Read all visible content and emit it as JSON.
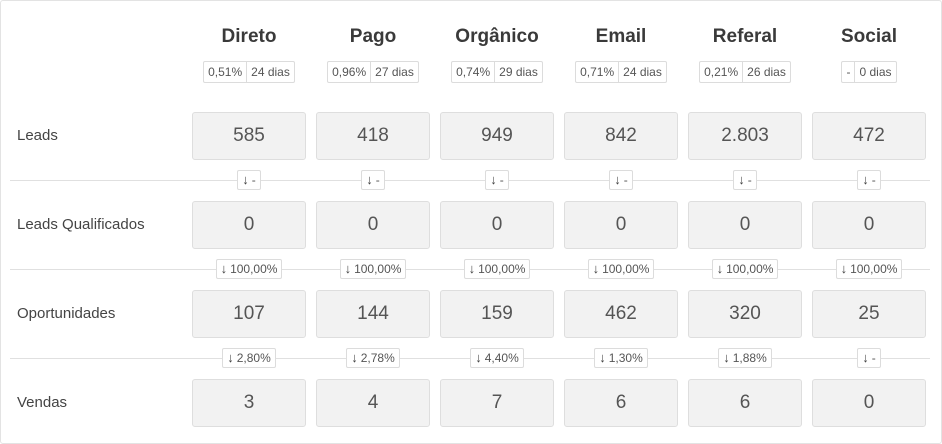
{
  "columns": [
    {
      "name": "Direto",
      "rate": "0,51%",
      "days": "24 dias"
    },
    {
      "name": "Pago",
      "rate": "0,96%",
      "days": "27 dias"
    },
    {
      "name": "Orgânico",
      "rate": "0,74%",
      "days": "29 dias"
    },
    {
      "name": "Email",
      "rate": "0,71%",
      "days": "24 dias"
    },
    {
      "name": "Referal",
      "rate": "0,21%",
      "days": "26 dias"
    },
    {
      "name": "Social",
      "rate": "-",
      "days": "0 dias"
    }
  ],
  "rows": [
    {
      "label": "Leads",
      "values": [
        "585",
        "418",
        "949",
        "842",
        "2.803",
        "472"
      ]
    },
    {
      "label": "Leads Qualificados",
      "values": [
        "0",
        "0",
        "0",
        "0",
        "0",
        "0"
      ]
    },
    {
      "label": "Oportunidades",
      "values": [
        "107",
        "144",
        "159",
        "462",
        "320",
        "25"
      ]
    },
    {
      "label": "Vendas",
      "values": [
        "3",
        "4",
        "7",
        "6",
        "6",
        "0"
      ]
    }
  ],
  "conversions": [
    [
      "-",
      "-",
      "-",
      "-",
      "-",
      "-"
    ],
    [
      "100,00%",
      "100,00%",
      "100,00%",
      "100,00%",
      "100,00%",
      "100,00%"
    ],
    [
      "2,80%",
      "2,78%",
      "4,40%",
      "1,30%",
      "1,88%",
      "-"
    ]
  ],
  "icons": {
    "arrow": "arrow-down-icon"
  }
}
